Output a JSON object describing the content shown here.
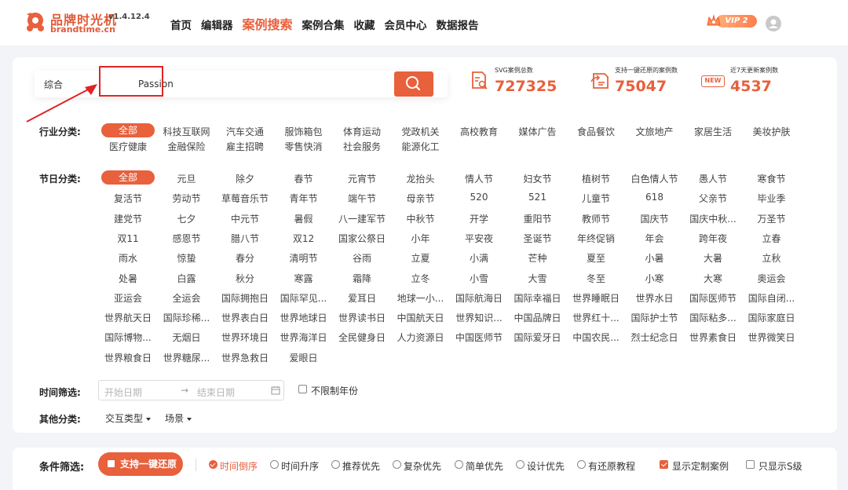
{
  "header": {
    "logo_name": "品牌时光机",
    "version": "v1.4.12.4",
    "logo_url": "brandtime.cn",
    "nav": [
      "首页",
      "编辑器",
      "案例搜索",
      "案例合集",
      "收藏",
      "会员中心",
      "数据报告"
    ],
    "active_nav": "案例搜索",
    "vip_label": "VIP 2"
  },
  "search": {
    "type": "综合",
    "value": "Passion"
  },
  "stats": [
    {
      "label": "SVG案例总数",
      "value": "727325",
      "icon": "document-search-icon"
    },
    {
      "label": "支持一键还原的案例数",
      "value": "75047",
      "icon": "restore-icon"
    },
    {
      "label": "近7天更新案例数",
      "value": "4537",
      "icon": "new-badge-icon",
      "badge": "NEW"
    }
  ],
  "industry": {
    "label": "行业分类:",
    "tags": [
      "全部",
      "科技互联网",
      "汽车交通",
      "服饰箱包",
      "体育运动",
      "党政机关",
      "高校教育",
      "媒体广告",
      "食品餐饮",
      "文旅地产",
      "家居生活",
      "美妆护肤",
      "医疗健康",
      "金融保险",
      "雇主招聘",
      "零售快消",
      "社会服务",
      "能源化工"
    ]
  },
  "festival": {
    "label": "节日分类:",
    "tags": [
      "全部",
      "元旦",
      "除夕",
      "春节",
      "元宵节",
      "龙抬头",
      "情人节",
      "妇女节",
      "植树节",
      "白色情人节",
      "愚人节",
      "寒食节",
      "复活节",
      "劳动节",
      "草莓音乐节",
      "青年节",
      "端午节",
      "母亲节",
      "520",
      "521",
      "儿童节",
      "618",
      "父亲节",
      "毕业季",
      "建党节",
      "七夕",
      "中元节",
      "暑假",
      "八一建军节",
      "中秋节",
      "开学",
      "重阳节",
      "教师节",
      "国庆节",
      "国庆中秋...",
      "万圣节",
      "双11",
      "感恩节",
      "腊八节",
      "双12",
      "国家公祭日",
      "小年",
      "平安夜",
      "圣诞节",
      "年终促销",
      "年会",
      "跨年夜",
      "立春",
      "雨水",
      "惊蛰",
      "春分",
      "清明节",
      "谷雨",
      "立夏",
      "小满",
      "芒种",
      "夏至",
      "小暑",
      "大暑",
      "立秋",
      "处暑",
      "白露",
      "秋分",
      "寒露",
      "霜降",
      "立冬",
      "小雪",
      "大雪",
      "冬至",
      "小寒",
      "大寒",
      "奥运会",
      "亚运会",
      "全运会",
      "国际拥抱日",
      "国际罕见...",
      "爱耳日",
      "地球一小...",
      "国际航海日",
      "国际幸福日",
      "世界睡眠日",
      "世界水日",
      "国际医师节",
      "国际自闭...",
      "世界航天日",
      "国际珍稀...",
      "世界表白日",
      "世界地球日",
      "世界读书日",
      "中国航天日",
      "世界知识...",
      "中国品牌日",
      "世界红十...",
      "国际护士节",
      "国际粘多...",
      "国际家庭日",
      "国际博物...",
      "无烟日",
      "世界环境日",
      "世界海洋日",
      "全民健身日",
      "人力资源日",
      "中国医师节",
      "国际爱牙日",
      "中国农民...",
      "烈士纪念日",
      "世界素食日",
      "世界微笑日",
      "世界粮食日",
      "世界糖尿...",
      "世界急救日",
      "爱眼日"
    ]
  },
  "time_filter": {
    "label": "时间筛选:",
    "start_placeholder": "开始日期",
    "arrow": "→",
    "end_placeholder": "结束日期",
    "unlimited_year": "不限制年份"
  },
  "other": {
    "label": "其他分类:",
    "dropdowns": [
      "交互类型",
      "场景"
    ]
  },
  "filter_bar": {
    "label": "条件筛选:",
    "restore_button": "支持一键还原",
    "radios": [
      {
        "label": "时间倒序",
        "checked": true
      },
      {
        "label": "时间升序",
        "checked": false
      },
      {
        "label": "推荐优先",
        "checked": false
      },
      {
        "label": "复杂优先",
        "checked": false
      },
      {
        "label": "简单优先",
        "checked": false
      },
      {
        "label": "设计优先",
        "checked": false
      },
      {
        "label": "有还原教程",
        "checked": false
      }
    ],
    "checkboxes": [
      {
        "label": "显示定制案例",
        "checked": true
      },
      {
        "label": "只显示S级",
        "checked": false
      }
    ]
  },
  "colors": {
    "accent": "#e8603c",
    "highlight": "#e02424"
  }
}
